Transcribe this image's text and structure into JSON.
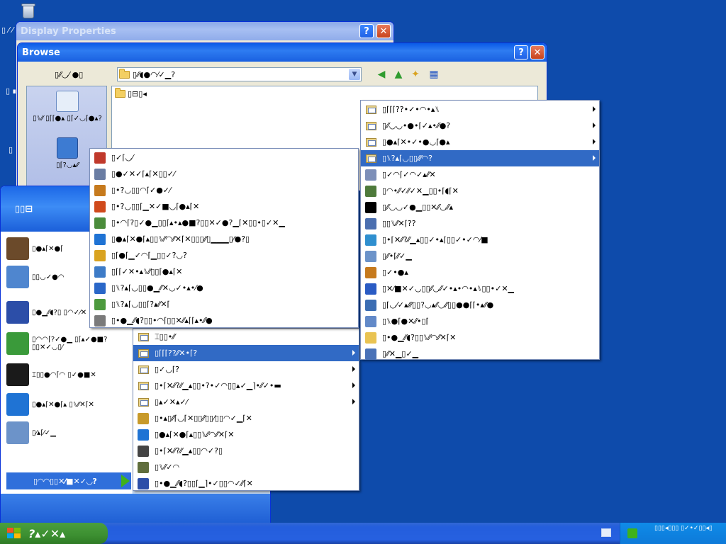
{
  "desktop": {
    "side_labels": [
      "▯ ⁄ ⁄",
      "▯ ▪",
      "▯ ▯",
      "▯"
    ]
  },
  "display_properties": {
    "title": "Display Properties",
    "help": "?",
    "close": "✕"
  },
  "browse": {
    "title": "Browse",
    "help": "?",
    "close": "✕",
    "lookin_label": "▯⁄⁄◡⁄ ●▯",
    "lookin_value": "▯⁄⁄◖●◠⁄✓▁?",
    "file_item": "▯⊟▯◂",
    "places": [
      {
        "label": "▯⑊⁄⁄ ▯⌈⌈●▴ ▯⌈✓◡⌈●▴?"
      },
      {
        "label": "▯⌈?◡▴⁄⁄"
      }
    ]
  },
  "start_menu": {
    "user": "▯▯⊟",
    "pinned": [
      {
        "label": "▯●▴⌈✕●⌈",
        "icon": "raccoon-icon",
        "color": "#6b4a2a"
      },
      {
        "label": "▯▯◡✓●◠",
        "icon": "mail-icon",
        "color": "#4f86cf"
      },
      {
        "label": "▯●▁⁄⁄◖?▯ ▯◠✓⁄✕",
        "icon": "media-player-icon",
        "color": "#2c4ea8"
      },
      {
        "label": "▯◠◠⌈?✓●▁ ▯⌈▴✓●■?▯▯✕✓◡▯⁄",
        "icon": "network-icon",
        "color": "#3a9a3a"
      },
      {
        "label": "⌶▯▯●◠⌈◠ ▯✓●■✕",
        "icon": "seven-zip-icon",
        "color": "#1a1a1a"
      },
      {
        "label": "▯●▴⌈✕●⌈▴ ▯⑊⁄⁄✕⌈✕",
        "icon": "internet-explorer-icon",
        "color": "#1f73d4"
      },
      {
        "label": "▯⁄▴⌈⁄✓▁",
        "icon": "notepad-icon",
        "color": "#6c93c9"
      }
    ],
    "all_programs": "▯◠◠▯▯✕⁄■✕✓◡?"
  },
  "menu1": {
    "items": [
      {
        "label": "▯✓⌈◡⁄",
        "icon": "brush-icon",
        "color": "#c0392b"
      },
      {
        "label": "▯●✓✕✓⌈▴⌈✕▯▯✓⁄",
        "icon": "scanner-icon",
        "color": "#6a7da3"
      },
      {
        "label": "▯•?◡▯▯◠⌈✓●✓⁄",
        "icon": "paint-icon",
        "color": "#c67a1d"
      },
      {
        "label": "▯•?◡▯▯⌈▁✕✓■◡⌈●▴⌈✕",
        "icon": "windows-icon",
        "color": "#d04a1c"
      },
      {
        "label": "▯•◠⌈?▯✓●▁▯▯⌈▴•▴●■?▯▯✕✓●?▁⌈✕▯▯•▯✓✕▁",
        "icon": "network-setup-icon",
        "color": "#4b8c3b"
      },
      {
        "label": "▯●▴⌈✕●⌈▴▯▯⑊⁄⁄◠⁄⁄✕⌈✕▯▯▯⁄⁄▯▁▁▁▯⁄●?▯",
        "icon": "internet-explorer-icon",
        "color": "#1f73d4"
      },
      {
        "label": "▯⌈●⌈▁✓◠⌈▁▯▯✓?◡?",
        "icon": "outlook-icon",
        "color": "#d9a320"
      },
      {
        "label": "▯⌈⌈✓✕•▴⑊⁄⁄▯▯⌈●▴⌈✕",
        "icon": "security-icon",
        "color": "#3d7bc7"
      },
      {
        "label": "▯⑊?▴⌈◡▯▯●▁⁄⁄✕◡✓•▴•⁄●",
        "icon": "info-icon",
        "color": "#2a67c8"
      },
      {
        "label": "▯⑊?▴⌈◡▯▯⌈?▴⁄⁄✕⌈",
        "icon": "update-icon",
        "color": "#4d9a3e"
      },
      {
        "label": "▯•●▁⁄⁄◖?▯▯•◠⌈▯▯✕⁄⁄▴⌈⌈▴•⁄⁄●",
        "icon": "window-icon",
        "color": "#7a7a7a"
      }
    ]
  },
  "menu2": {
    "items": [
      {
        "label": "⌶▯▯•⁄⁄",
        "icon": "program-folder-icon",
        "color": "#e9d38a",
        "arrow": false,
        "selected": false
      },
      {
        "label": "▯⌈⌈⌈??⁄⁄✕•⌈?",
        "icon": "program-folder-icon",
        "color": "#e9d38a",
        "arrow": true,
        "selected": true
      },
      {
        "label": "▯✓◡⌈?",
        "icon": "program-folder-icon",
        "color": "#e9d38a",
        "arrow": true,
        "selected": false
      },
      {
        "label": "▯•⌈✕⁄⁄?⁄⁄▁▴▯▯•?•✓◠▯▯▴✓▁⌉•⁄⁄✓•▬",
        "icon": "program-folder-icon",
        "color": "#e9d38a",
        "arrow": true,
        "selected": false
      },
      {
        "label": "▯▴✓✕▴✓⁄",
        "icon": "program-folder-icon",
        "color": "#e9d38a",
        "arrow": true,
        "selected": false
      },
      {
        "label": "▯•▴▯⁄⁄⌈◡⌈✕▯▯⁄⁄▯▯⁄▯▯◠✓▁⌈✕",
        "icon": "dog-icon",
        "color": "#c89a2a",
        "arrow": false,
        "selected": false
      },
      {
        "label": "▯●▴⌈✕●⌈▴▯▯⑊⁄⁄◠⁄⁄✕⌈✕",
        "icon": "internet-explorer-icon",
        "color": "#1f73d4",
        "arrow": false,
        "selected": false
      },
      {
        "label": "▯•⌈✕⁄⁄?⁄⁄▁▴▯▯◠✓?▯",
        "icon": "exclamation-icon",
        "color": "#444444",
        "arrow": false,
        "selected": false
      },
      {
        "label": "▯⑊⁄⁄✓◠",
        "icon": "messenger-icon",
        "color": "#5f6d3c",
        "arrow": false,
        "selected": false
      },
      {
        "label": "▯•●▁⁄⁄◖?▯▯⌈▁⌉•✓▯▯◠✓⁄⁄⌈✕",
        "icon": "media-player-icon",
        "color": "#2c4ea8",
        "arrow": false,
        "selected": false
      }
    ]
  },
  "menu3": {
    "items": [
      {
        "label": "▯⌈⌈⌈??•✓•◠•▴⑊",
        "icon": "program-folder-icon",
        "color": "#e9d38a",
        "arrow": true,
        "selected": false
      },
      {
        "label": "▯⁄⁄◡◡•●•⌈✓▴•⁄⁄●?",
        "icon": "program-folder-icon",
        "color": "#e9d38a",
        "arrow": true,
        "selected": false
      },
      {
        "label": "▯●▴⌈✕•✓•●◡⌈●▴",
        "icon": "program-folder-icon",
        "color": "#e9d38a",
        "arrow": true,
        "selected": false
      },
      {
        "label": "▯⑊?▴⌈◡▯▯⁄⁄⁄◠?",
        "icon": "program-folder-icon",
        "color": "#e9d38a",
        "arrow": true,
        "selected": true
      },
      {
        "label": "▯✓◠⌈✓◠✓▴⁄⁄✕",
        "icon": "calculator-icon",
        "color": "#7d8fb8",
        "arrow": false,
        "selected": false
      },
      {
        "label": "▯◠•⁄⁄✓⁄⁄✓✕▁▯▯•⌈◖⌈✕",
        "icon": "address-book-icon",
        "color": "#4e7a3b",
        "arrow": false,
        "selected": false
      },
      {
        "label": "▯⁄⁄◡◡✓●▁▯▯✕⁄⁄◡⁄⁄▴",
        "icon": "command-prompt-icon",
        "color": "#000000",
        "arrow": false,
        "selected": false
      },
      {
        "label": "▯▯⑊⁄⁄✕⌈??",
        "icon": "computer-icon",
        "color": "#4b6fb0",
        "arrow": false,
        "selected": false
      },
      {
        "label": "▯•⌈✕⁄⁄?⁄⁄▁▴▯▯✓•▴⌈▯▯✓•✓◠⁄■",
        "icon": "globe-icon",
        "color": "#2f8fcf",
        "arrow": false,
        "selected": false
      },
      {
        "label": "▯⁄⁄•⌈⁄⁄✓▁",
        "icon": "notepad-icon",
        "color": "#6c93c9",
        "arrow": false,
        "selected": false
      },
      {
        "label": "▯✓•●▴",
        "icon": "paint-icon",
        "color": "#c67a1d",
        "arrow": false,
        "selected": false
      },
      {
        "label": "▯✕⁄■✕✓◡▯▯⁄⁄◡⁄⁄✓•▴•◠•▴⑊▯▯•✓✕▁",
        "icon": "help-icon",
        "color": "#2a5bc4",
        "arrow": false,
        "selected": false
      },
      {
        "label": "▯⌈◡⁄✓▴⁄⁄⁄▯▯?◡▴⁄⁄◡⁄⁄▯▯●●⌈⌈•▴⁄⁄●",
        "icon": "remote-desktop-icon",
        "color": "#3b6db3",
        "arrow": false,
        "selected": false
      },
      {
        "label": "▯⑊●⌈●✕⁄⁄•▯⌈",
        "icon": "sync-icon",
        "color": "#6289c8",
        "arrow": false,
        "selected": false
      },
      {
        "label": "▯•●▁⁄⁄◖?▯▯⑊⁄⁄◠⁄⁄✕⌈✕",
        "icon": "explorer-folder-icon",
        "color": "#e9c352",
        "arrow": false,
        "selected": false
      },
      {
        "label": "▯⁄⁄✕▁▯✓▁",
        "icon": "wordpad-icon",
        "color": "#4a72b8",
        "arrow": false,
        "selected": false
      }
    ]
  },
  "taskbar": {
    "start_label": "?▴✓✕▴",
    "tray_text": "▯▯▯◂▯▯▯ ▯✓•✓▯▯◂▯"
  }
}
